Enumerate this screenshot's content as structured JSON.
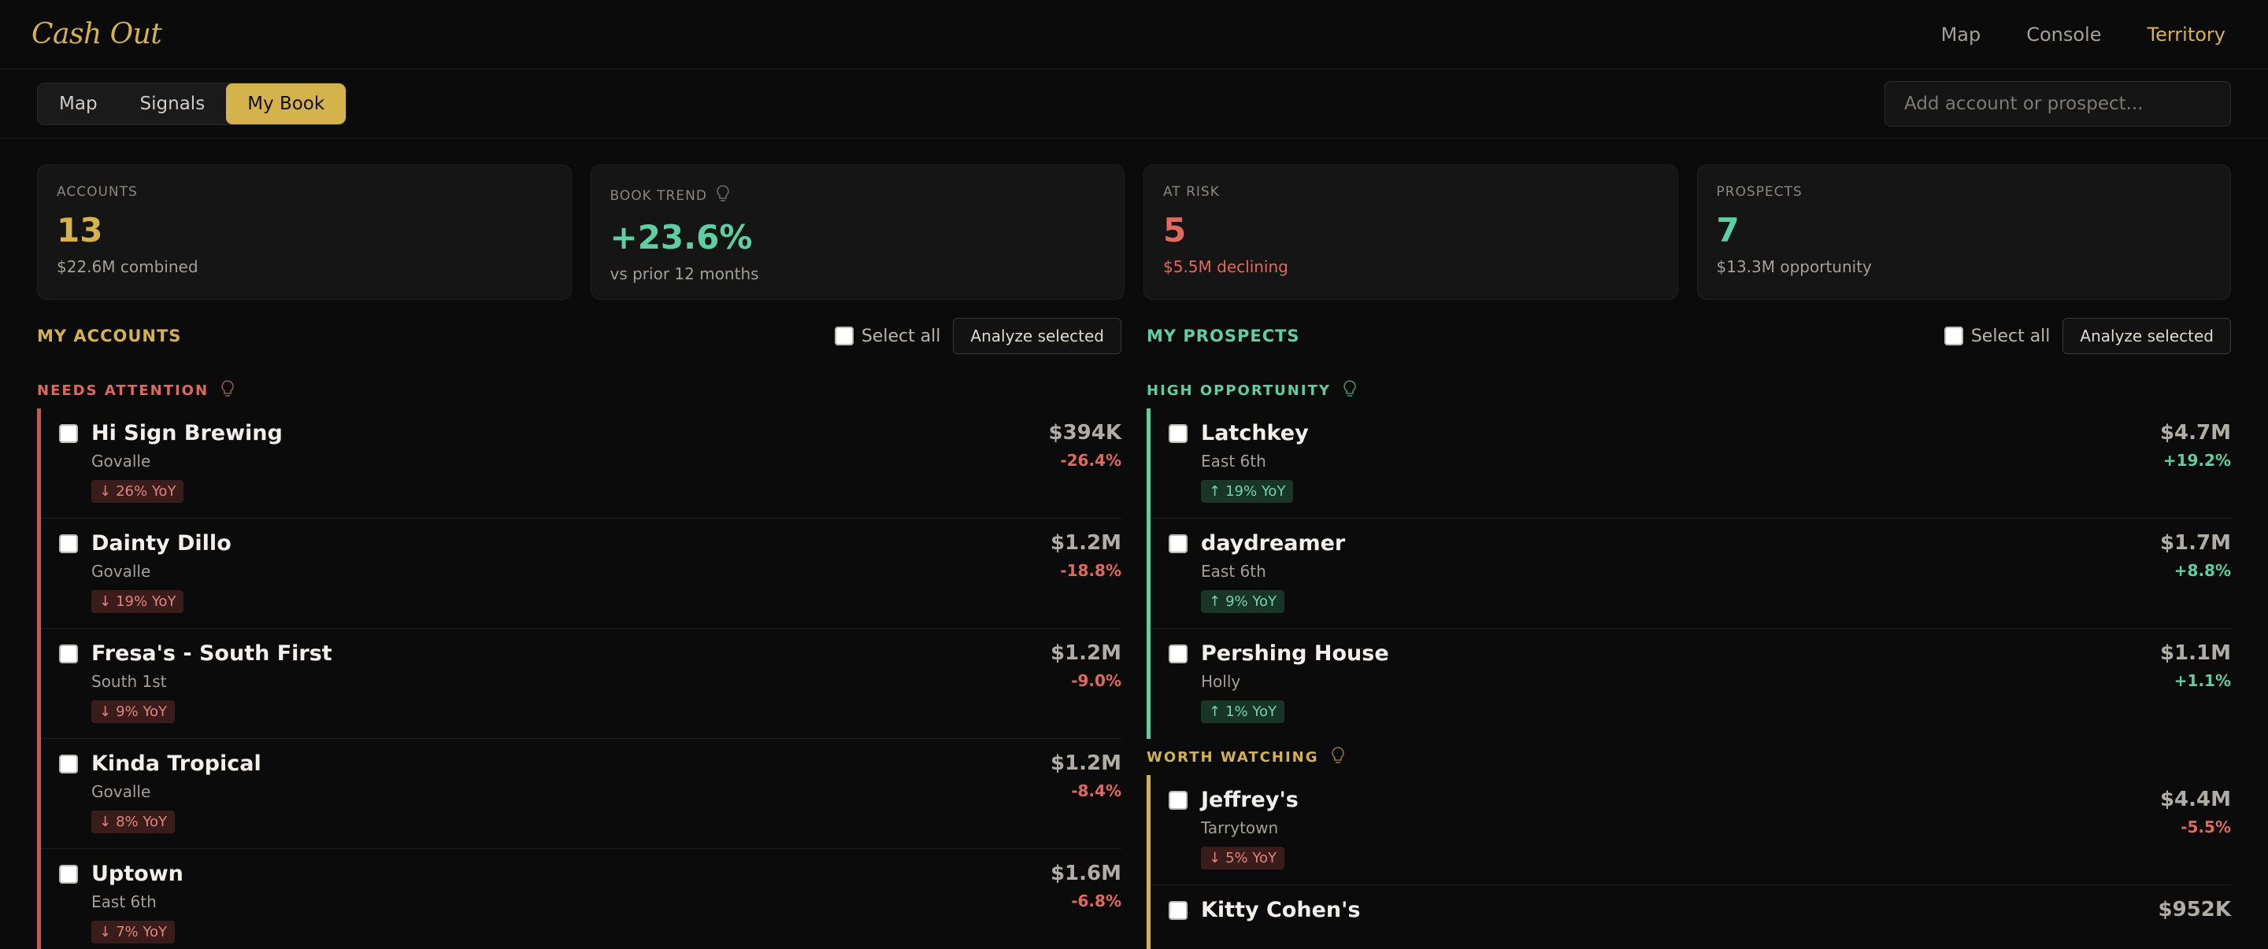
{
  "app": {
    "brand": "Cash Out"
  },
  "topnav": [
    {
      "label": "Map"
    },
    {
      "label": "Console"
    },
    {
      "label": "Territory"
    }
  ],
  "tabs": [
    {
      "label": "Map"
    },
    {
      "label": "Signals"
    },
    {
      "label": "My Book"
    }
  ],
  "search": {
    "placeholder": "Add account or prospect..."
  },
  "stats": [
    {
      "label": "ACCOUNTS",
      "value": "13",
      "sub": "$22.6M combined"
    },
    {
      "label": "BOOK TREND",
      "value": "+23.6%",
      "sub": "vs prior 12 months"
    },
    {
      "label": "AT RISK",
      "value": "5",
      "sub": "$5.5M declining"
    },
    {
      "label": "PROSPECTS",
      "value": "7",
      "sub": "$13.3M opportunity"
    }
  ],
  "accounts": {
    "title": "MY ACCOUNTS",
    "select_all": "Select all",
    "analyze": "Analyze selected",
    "group_label": "NEEDS ATTENTION",
    "rows": [
      {
        "name": "Hi Sign Brewing",
        "location": "Govalle",
        "badge": "26% YoY",
        "amount": "$394K",
        "change": "-26.4%"
      },
      {
        "name": "Dainty Dillo",
        "location": "Govalle",
        "badge": "19% YoY",
        "amount": "$1.2M",
        "change": "-18.8%"
      },
      {
        "name": "Fresa's - South First",
        "location": "South 1st",
        "badge": "9% YoY",
        "amount": "$1.2M",
        "change": "-9.0%"
      },
      {
        "name": "Kinda Tropical",
        "location": "Govalle",
        "badge": "8% YoY",
        "amount": "$1.2M",
        "change": "-8.4%"
      },
      {
        "name": "Uptown",
        "location": "East 6th",
        "badge": "7% YoY",
        "amount": "$1.6M",
        "change": "-6.8%"
      }
    ]
  },
  "prospects": {
    "title": "MY PROSPECTS",
    "select_all": "Select all",
    "analyze": "Analyze selected",
    "high_label": "HIGH OPPORTUNITY",
    "high_rows": [
      {
        "name": "Latchkey",
        "location": "East 6th",
        "badge": "19% YoY",
        "amount": "$4.7M",
        "change": "+19.2%"
      },
      {
        "name": "daydreamer",
        "location": "East 6th",
        "badge": "9% YoY",
        "amount": "$1.7M",
        "change": "+8.8%"
      },
      {
        "name": "Pershing House",
        "location": "Holly",
        "badge": "1% YoY",
        "amount": "$1.1M",
        "change": "+1.1%"
      }
    ],
    "watch_label": "WORTH WATCHING",
    "watch_rows": [
      {
        "name": "Jeffrey's",
        "location": "Tarrytown",
        "badge": "5% YoY",
        "amount": "$4.4M",
        "change": "-5.5%"
      },
      {
        "name": "Kitty Cohen's",
        "amount": "$952K"
      }
    ]
  },
  "colors": {
    "accent": "#d4b24c",
    "positive": "#5ecfa3",
    "negative": "#e0695d"
  }
}
